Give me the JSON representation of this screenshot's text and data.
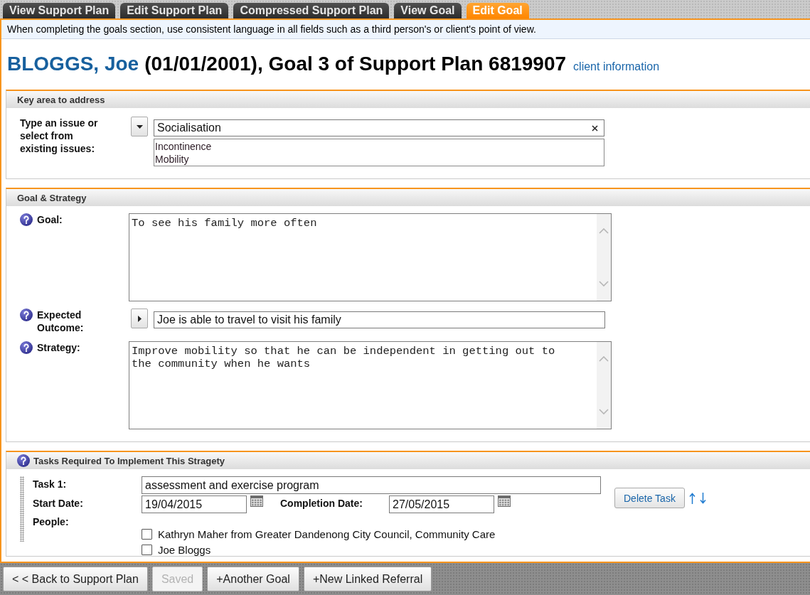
{
  "tabs": [
    {
      "label": "View Support Plan",
      "selected": false
    },
    {
      "label": "Edit Support Plan",
      "selected": false
    },
    {
      "label": "Compressed Support Plan",
      "selected": false
    },
    {
      "label": "View Goal",
      "selected": false
    },
    {
      "label": "Edit Goal",
      "selected": true
    }
  ],
  "notice": "When completing the goals section, use consistent language in all fields such as a third person's or client's point of view.",
  "heading": {
    "client_name": "BLOGGS, Joe",
    "details": "(01/01/2001), Goal 3 of Support Plan 6819907",
    "link": "client information"
  },
  "key_area": {
    "title": "Key area to address",
    "label": "Type an issue or select from existing issues:",
    "issue_value": "Socialisation",
    "suggestions": [
      "Incontinence",
      "Mobility"
    ]
  },
  "goal_strategy": {
    "title": "Goal & Strategy",
    "fields": [
      {
        "kind": "textarea",
        "label": "Goal:",
        "value": "To see his family more often"
      },
      {
        "kind": "picker",
        "label": "Expected Outcome:",
        "value": "Joe is able to travel to visit his family"
      },
      {
        "kind": "textarea",
        "label": "Strategy:",
        "value": "Improve mobility so that he can be independent in getting out to the community when he wants"
      }
    ]
  },
  "tasks": {
    "title": "Tasks Required To Implement This Stragety",
    "items": [
      {
        "label": "Task 1:",
        "value": "assessment and exercise program",
        "start_label": "Start Date:",
        "start_date": "19/04/2015",
        "completion_label": "Completion Date:",
        "completion_date": "27/05/2015",
        "delete_button": "Delete Task",
        "people_label": "People:",
        "people": [
          {
            "name": "Kathryn Maher from Greater Dandenong City Council, Community Care",
            "checked": false
          },
          {
            "name": "Joe Bloggs",
            "checked": false
          }
        ]
      }
    ]
  },
  "footer_buttons": [
    {
      "label": "< < Back to Support Plan",
      "disabled": false
    },
    {
      "label": "Saved",
      "disabled": true
    },
    {
      "label": "+Another Goal",
      "disabled": false
    },
    {
      "label": "+New Linked Referral",
      "disabled": false
    }
  ]
}
